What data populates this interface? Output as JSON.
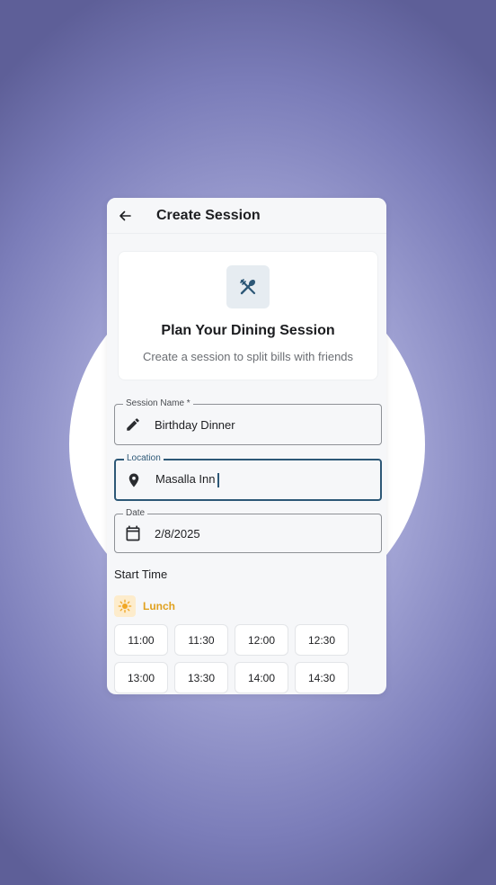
{
  "appbar": {
    "title": "Create Session",
    "back_icon": "arrow-left-icon"
  },
  "hero": {
    "icon": "utensils-icon",
    "title": "Plan Your Dining Session",
    "subtitle": "Create a session to split bills with friends"
  },
  "form": {
    "session_name": {
      "label": "Session Name *",
      "value": "Birthday Dinner",
      "icon": "pencil-icon"
    },
    "location": {
      "label": "Location",
      "value": "Masalla Inn",
      "icon": "map-pin-icon"
    },
    "date": {
      "label": "Date",
      "value": "2/8/2025",
      "icon": "calendar-icon"
    }
  },
  "start_time": {
    "title": "Start Time",
    "period": {
      "label": "Lunch",
      "icon": "sun-icon",
      "color": "#e0a11f"
    },
    "slots": [
      "11:00",
      "11:30",
      "12:00",
      "12:30",
      "13:00",
      "13:30",
      "14:00",
      "14:30"
    ]
  },
  "colors": {
    "accent": "#2d5877",
    "lunch": "#e0a11f",
    "background": "#8c8ec6"
  }
}
